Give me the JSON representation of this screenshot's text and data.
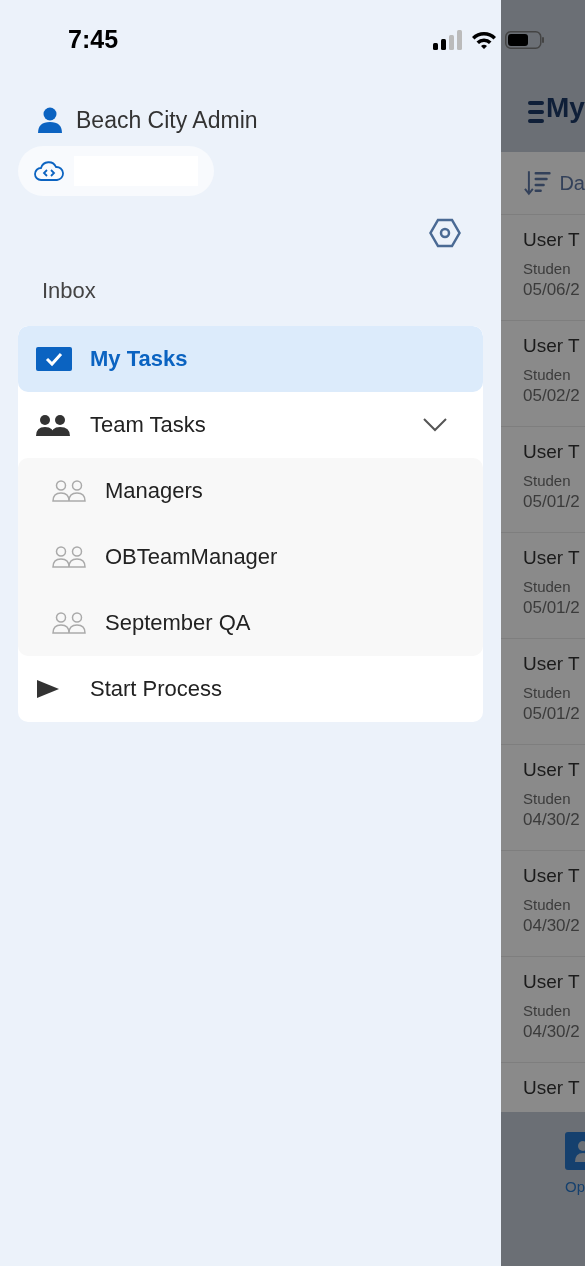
{
  "status_bar": {
    "time": "7:45"
  },
  "user": {
    "name": "Beach City Admin"
  },
  "inbox_heading": "Inbox",
  "menu": {
    "items": [
      {
        "kind": "tasks",
        "label": "My Tasks",
        "selected": true
      },
      {
        "kind": "group",
        "label": "Team Tasks",
        "selected": false,
        "expanded": true,
        "children": [
          {
            "label": "Managers",
            "selected": false
          },
          {
            "label": "OBTeamManager",
            "selected": false
          },
          {
            "label": "September QA",
            "selected": false
          }
        ]
      },
      {
        "kind": "action",
        "label": "Start Process",
        "selected": false
      }
    ]
  },
  "background_screen": {
    "title": "My",
    "sort_label": "Da",
    "tasks": [
      {
        "title": "User T",
        "subtitle": "Studen",
        "date": "05/06/2"
      },
      {
        "title": "User T",
        "subtitle": "Studen",
        "date": "05/02/2"
      },
      {
        "title": "User T",
        "subtitle": "Studen",
        "date": "05/01/2"
      },
      {
        "title": "User T",
        "subtitle": "Studen",
        "date": "05/01/2"
      },
      {
        "title": "User T",
        "subtitle": "Studen",
        "date": "05/01/2"
      },
      {
        "title": "User T",
        "subtitle": "Studen",
        "date": "04/30/2"
      },
      {
        "title": "User T",
        "subtitle": "Studen",
        "date": "04/30/2"
      },
      {
        "title": "User T",
        "subtitle": "Studen",
        "date": "04/30/2"
      },
      {
        "title": "User T"
      }
    ],
    "bottom_tab": {
      "label": "Op"
    }
  }
}
